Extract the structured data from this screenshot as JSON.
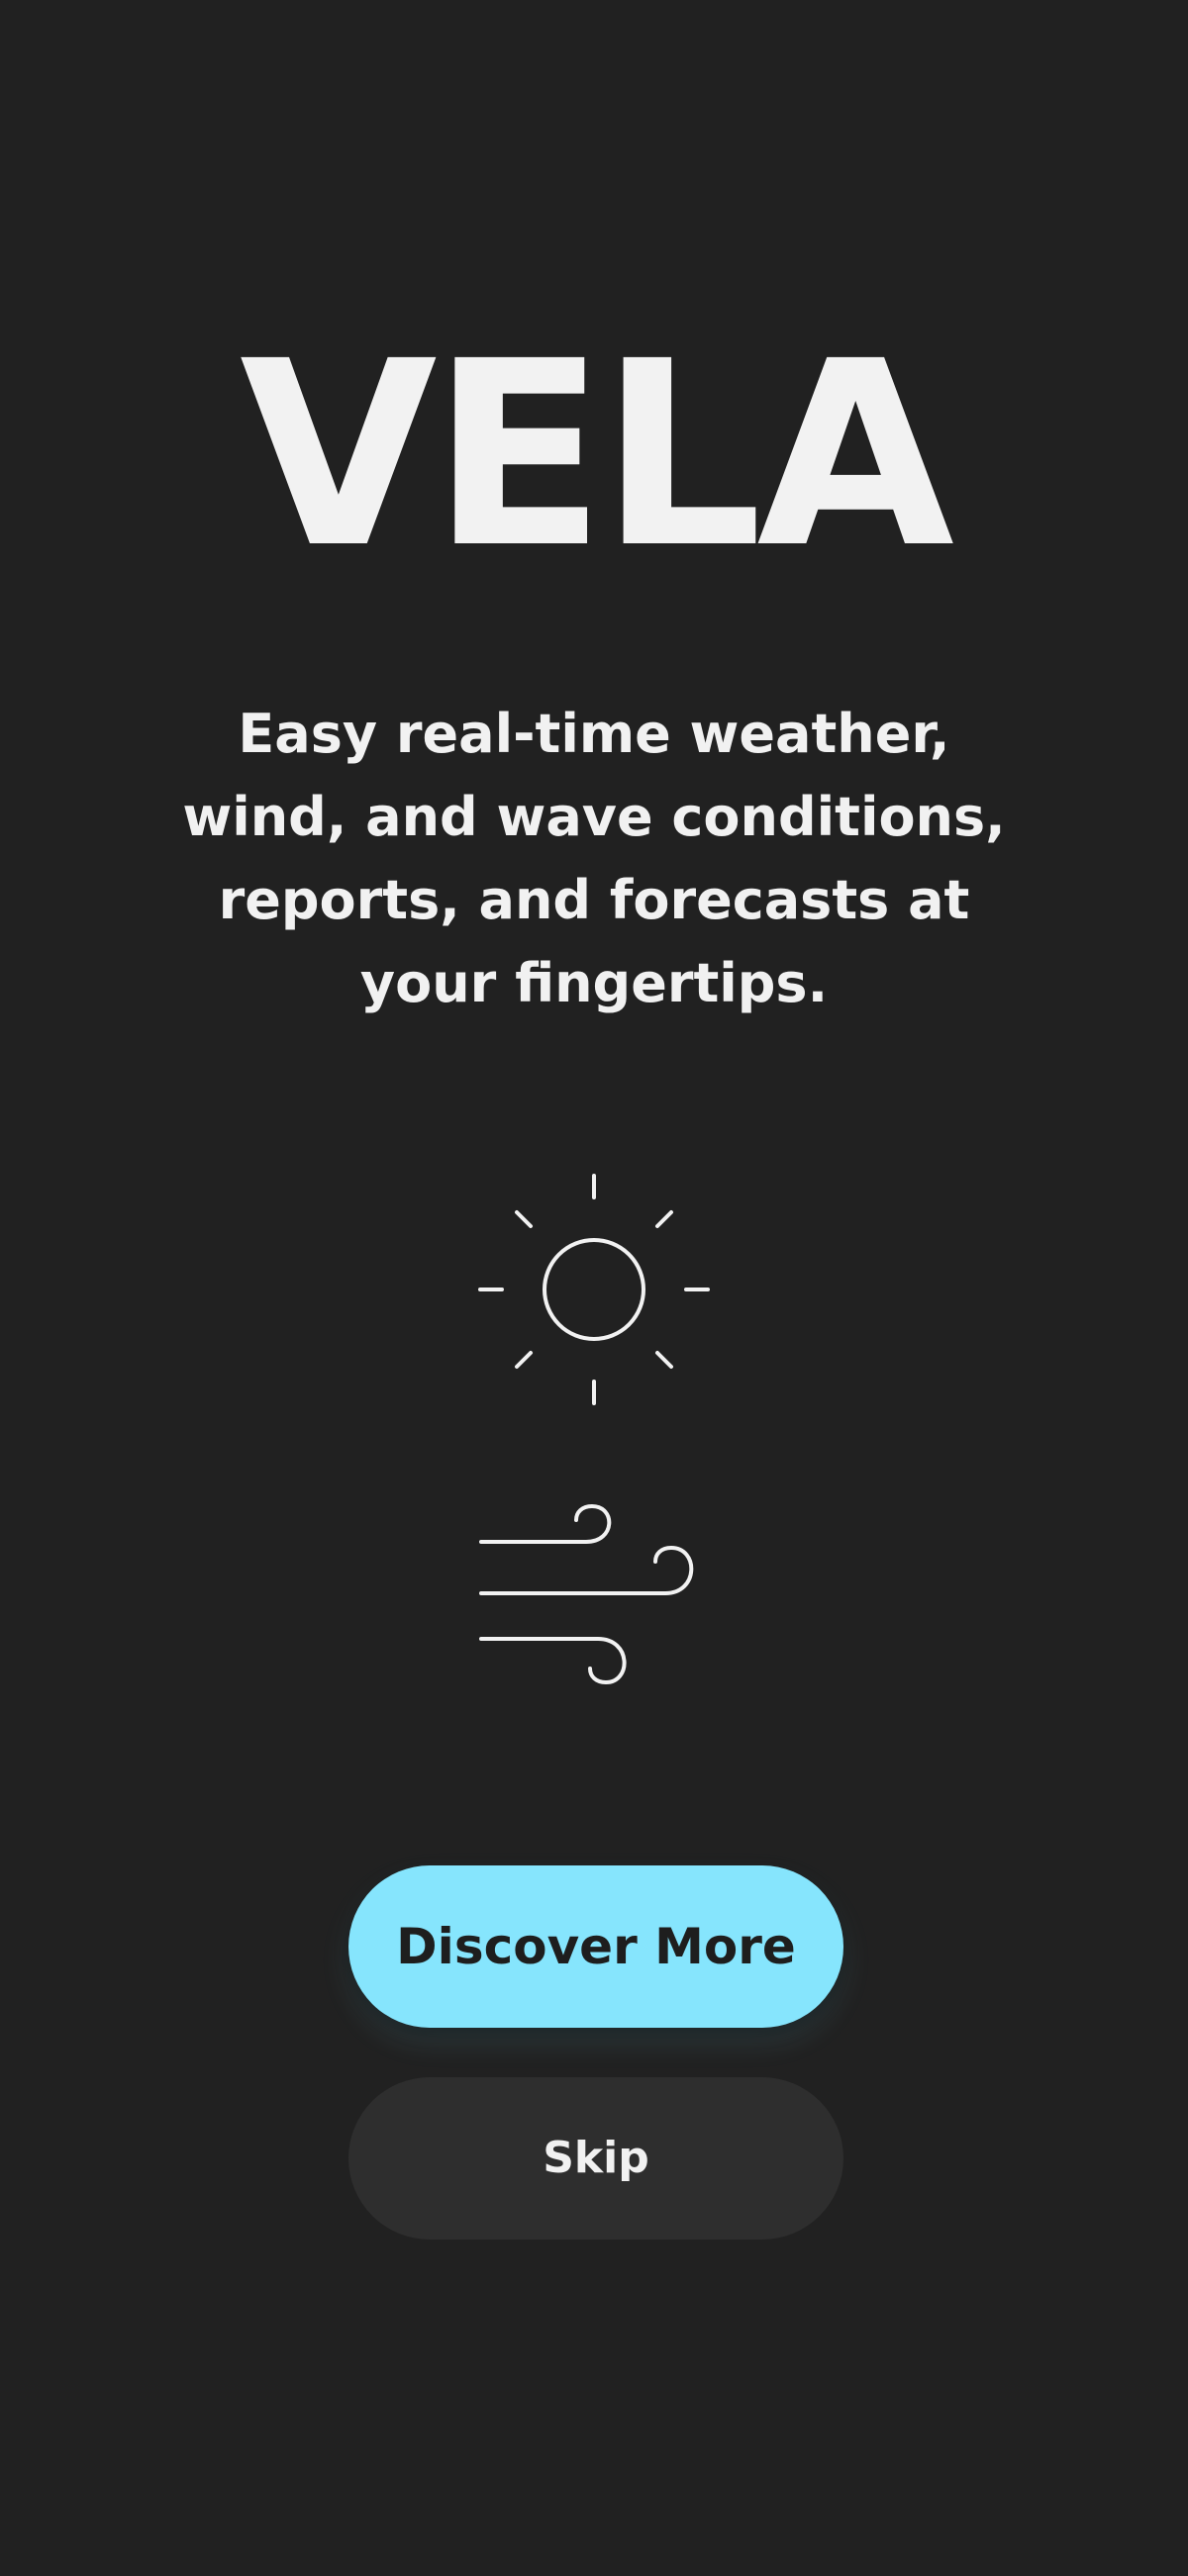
{
  "app": {
    "title": "VELA"
  },
  "tagline": {
    "lines": [
      "Easy real-time weather,",
      "wind, and wave conditions,",
      "reports, and forecasts at",
      "your fingertips."
    ]
  },
  "icons": {
    "sun": "sun-icon",
    "wind": "wind-icon"
  },
  "actions": {
    "primary_label": "Discover More",
    "secondary_label": "Skip"
  },
  "colors": {
    "background": "#212121",
    "text": "#f1f1f1",
    "accent": "#86e5fd",
    "secondary_button": "#2e2e2e"
  }
}
